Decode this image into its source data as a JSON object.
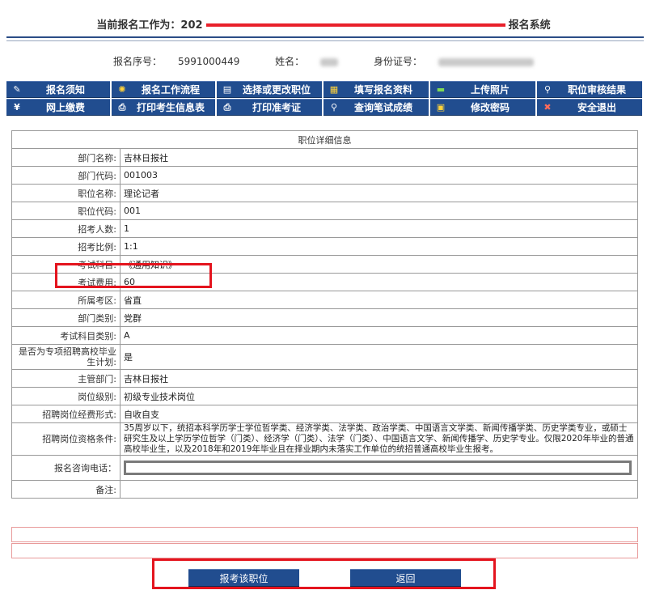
{
  "header": {
    "title_prefix": "当前报名工作为：202",
    "title_suffix": "报名系统"
  },
  "applicant": {
    "seq_label": "报名序号：",
    "seq_value": "5991000449",
    "name_label": "姓名：",
    "id_label": "身份证号："
  },
  "nav": {
    "row1": [
      {
        "icon": "notice-icon",
        "glyph": "✎",
        "label": "报名须知"
      },
      {
        "icon": "sun-icon",
        "glyph": "✺",
        "label": "报名工作流程"
      },
      {
        "icon": "list-icon",
        "glyph": "▤",
        "label": "选择或更改职位"
      },
      {
        "icon": "form-icon",
        "glyph": "▦",
        "label": "填写报名资料"
      },
      {
        "icon": "upload-icon",
        "glyph": "▬",
        "label": "上传照片"
      },
      {
        "icon": "key-icon",
        "glyph": "⚲",
        "label": "职位审核结果"
      }
    ],
    "row2": [
      {
        "icon": "yen-icon",
        "glyph": "¥",
        "label": "网上缴费"
      },
      {
        "icon": "printer-icon",
        "glyph": "⎙",
        "label": "打印考生信息表"
      },
      {
        "icon": "printer-icon",
        "glyph": "⎙",
        "label": "打印准考证"
      },
      {
        "icon": "key-icon",
        "glyph": "⚲",
        "label": "查询笔试成绩"
      },
      {
        "icon": "lock-icon",
        "glyph": "▣",
        "label": "修改密码"
      },
      {
        "icon": "exit-icon",
        "glyph": "✖",
        "label": "安全退出"
      }
    ]
  },
  "detail": {
    "heading": "职位详细信息",
    "rows": [
      {
        "label": "部门名称:",
        "value": "吉林日报社"
      },
      {
        "label": "部门代码:",
        "value": "001003"
      },
      {
        "label": "职位名称:",
        "value": "理论记者"
      },
      {
        "label": "职位代码:",
        "value": "001"
      },
      {
        "label": "招考人数:",
        "value": "1"
      },
      {
        "label": "招考比例:",
        "value": "1:1"
      },
      {
        "label": "考试科目:",
        "value": "《通用知识》"
      },
      {
        "label": "考试费用:",
        "value": "60"
      },
      {
        "label": "所属考区:",
        "value": "省直"
      },
      {
        "label": "部门类别:",
        "value": "党群"
      },
      {
        "label": "考试科目类别:",
        "value": "A"
      },
      {
        "label": "是否为专项招聘高校毕业生计划:",
        "value": "是"
      },
      {
        "label": "主管部门:",
        "value": "吉林日报社"
      },
      {
        "label": "岗位级别:",
        "value": "初级专业技术岗位"
      },
      {
        "label": "招聘岗位经费形式:",
        "value": "自收自支"
      },
      {
        "label": "招聘岗位资格条件:",
        "value": "35周岁以下，统招本科学历学士学位哲学类、经济学类、法学类、政治学类、中国语言文学类、新闻传播学类、历史学类专业，或硕士研究生及以上学历学位哲学（门类）、经济学（门类）、法学（门类）、中国语言文学、新闻传播学、历史学专业。仅限2020年毕业的普通高校毕业生，以及2018年和2019年毕业且在择业期内未落实工作单位的统招普通高校毕业生报考。"
      },
      {
        "label": "报名咨询电话：",
        "value": ""
      },
      {
        "label": "备注:",
        "value": ""
      }
    ]
  },
  "buttons": {
    "apply": "报考该职位",
    "back": "返回"
  }
}
